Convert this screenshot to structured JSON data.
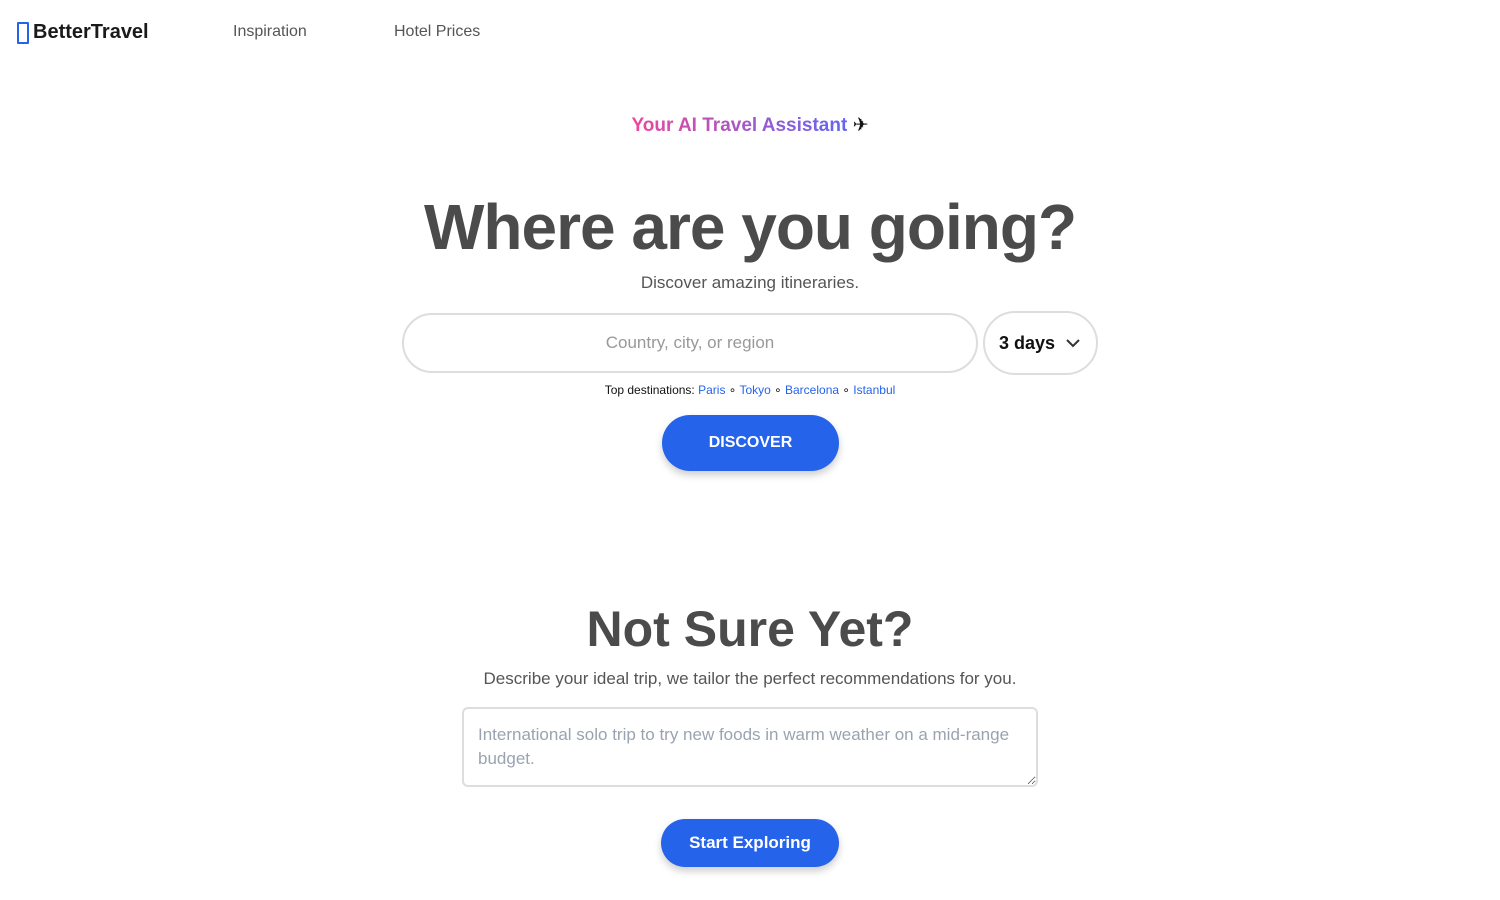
{
  "nav": {
    "brand": "BetterTravel",
    "brand_icon": "missing-glyph-box",
    "links": [
      "Inspiration",
      "Hotel Prices"
    ]
  },
  "hero": {
    "tagline": "Your AI Travel Assistant",
    "tagline_icon": "✈",
    "title": "Where are you going?",
    "subtitle": "Discover amazing itineraries.",
    "search_placeholder": "Country, city, or region",
    "duration": "3 days",
    "top_label": "Top destinations:",
    "destinations": [
      "Paris",
      "Tokyo",
      "Barcelona",
      "Istanbul"
    ],
    "separator": "∘",
    "discover_label": "DISCOVER"
  },
  "explore": {
    "title": "Not Sure Yet?",
    "subtitle": "Describe your ideal trip, we tailor the perfect recommendations for you.",
    "placeholder": "International solo trip to try new foods in warm weather on a mid-range budget.",
    "button_label": "Start Exploring"
  },
  "colors": {
    "accent": "#2563eb",
    "gradient_start": "#ec4899",
    "gradient_end": "#6366f1"
  }
}
